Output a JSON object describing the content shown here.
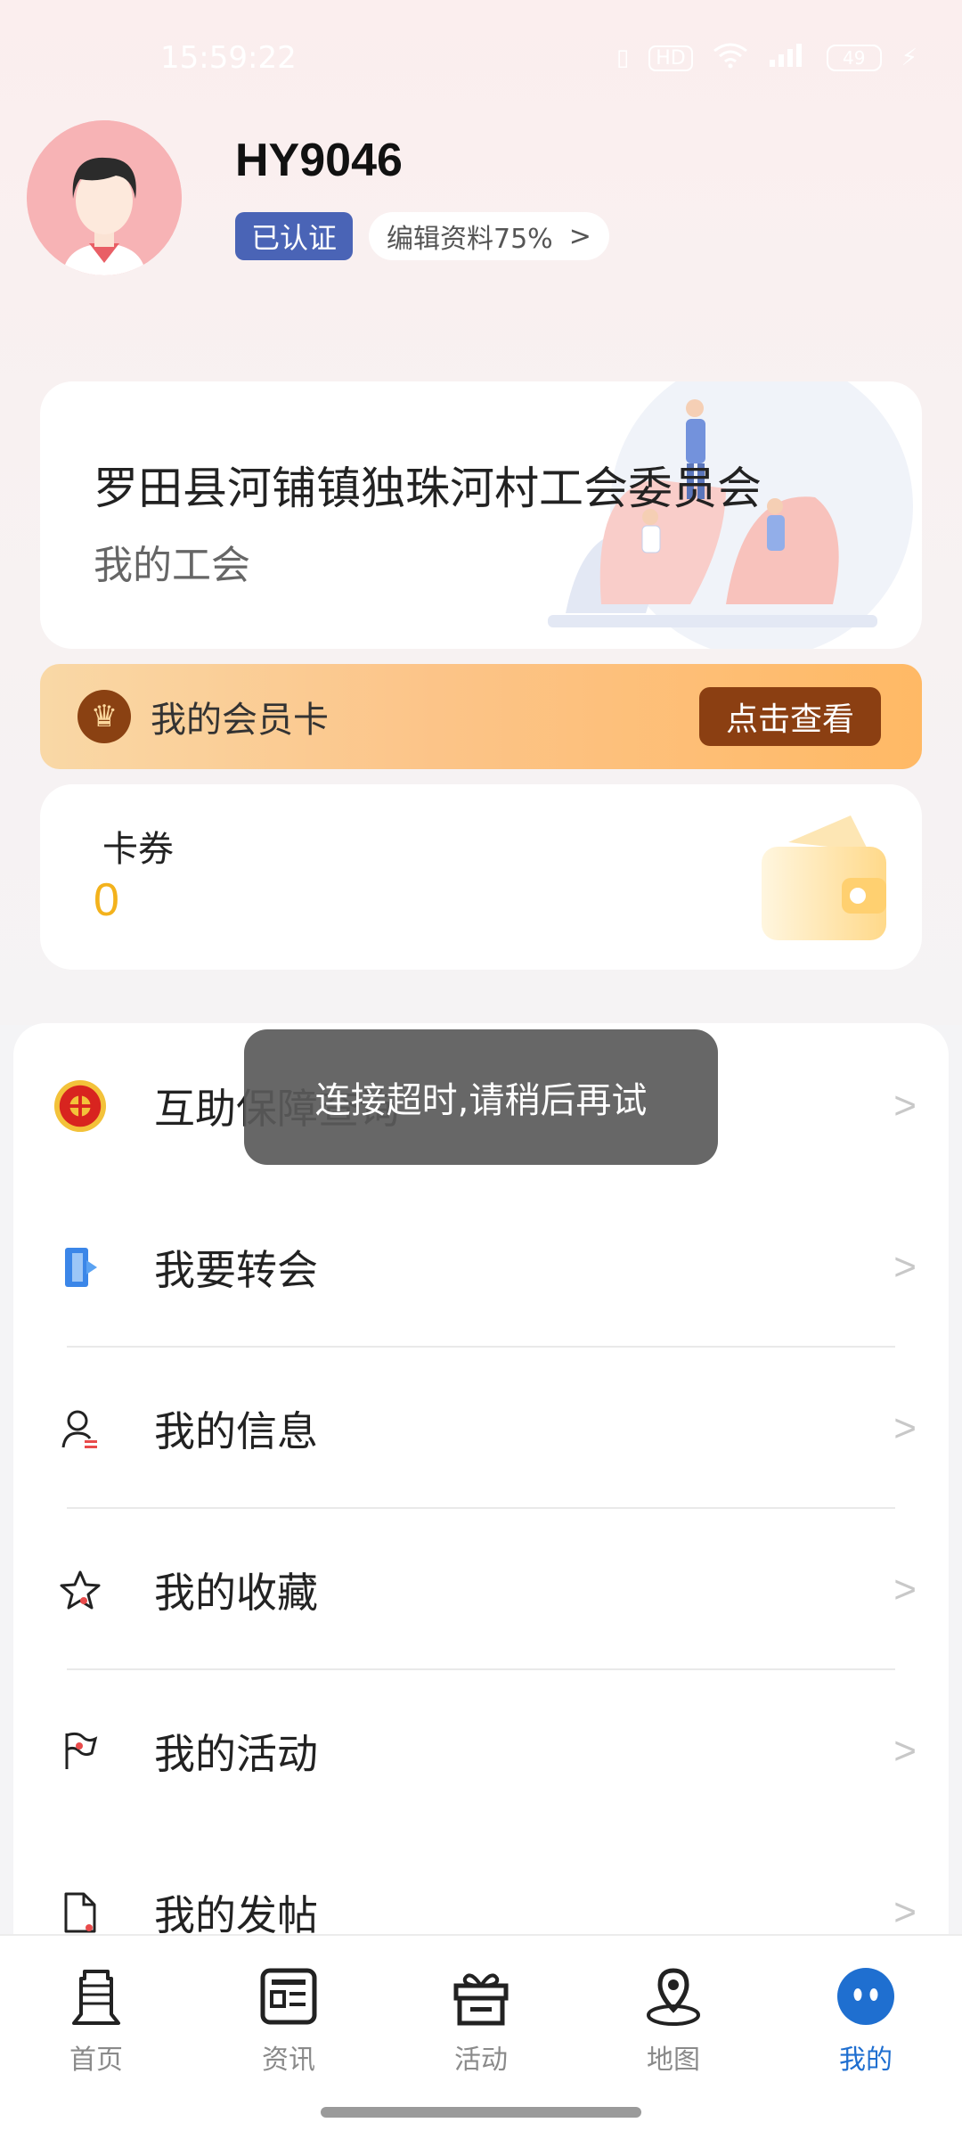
{
  "status_bar": {
    "time": "15:59:22",
    "hd": "HD",
    "battery": "49"
  },
  "profile": {
    "username": "HY9046",
    "verified_label": "已认证",
    "edit_label": "编辑资料75%",
    "edit_arrow": ">"
  },
  "union": {
    "name": "罗田县河铺镇独珠河村工会委员会",
    "subtitle": "我的工会"
  },
  "member_card": {
    "label": "我的会员卡",
    "button": "点击查看"
  },
  "coupons": {
    "label": "卡券",
    "value": "0"
  },
  "toast": "连接超时,请稍后再试",
  "menu": [
    {
      "label": "互助保障查询",
      "icon": "mutual-aid-emblem-icon"
    },
    {
      "label": "我要转会",
      "icon": "transfer-door-icon"
    },
    {
      "label": "我的信息",
      "icon": "user-info-icon"
    },
    {
      "label": "我的收藏",
      "icon": "star-icon"
    },
    {
      "label": "我的活动",
      "icon": "flag-icon"
    },
    {
      "label": "我的发帖",
      "icon": "post-document-icon"
    }
  ],
  "menu_arrow": ">",
  "bottom_nav": [
    {
      "label": "首页",
      "icon": "home-tower-icon"
    },
    {
      "label": "资讯",
      "icon": "news-icon"
    },
    {
      "label": "活动",
      "icon": "gift-icon"
    },
    {
      "label": "地图",
      "icon": "map-pin-icon"
    },
    {
      "label": "我的",
      "icon": "profile-face-icon",
      "active": true
    }
  ],
  "colors": {
    "accent": "#1f6fd0",
    "badge": "#4a64b6",
    "member_button": "#8b3f12",
    "coupon_value": "#f3b21c"
  }
}
